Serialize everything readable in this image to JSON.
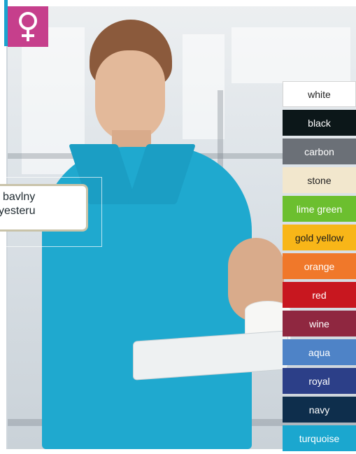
{
  "badge": {
    "icon": "female-symbol-icon",
    "color": "#c63f8c"
  },
  "callout": {
    "line1": "bavlny",
    "line2": "yesteru"
  },
  "colors": [
    {
      "label": "white",
      "bg": "#ffffff",
      "fg": "#222222"
    },
    {
      "label": "black",
      "bg": "#0c1719",
      "fg": "#ffffff"
    },
    {
      "label": "carbon",
      "bg": "#6b7077",
      "fg": "#ffffff"
    },
    {
      "label": "stone",
      "bg": "#f2e7cd",
      "fg": "#222222"
    },
    {
      "label": "lime green",
      "bg": "#6cbf2f",
      "fg": "#ffffff"
    },
    {
      "label": "gold yellow",
      "bg": "#f8b618",
      "fg": "#1a1a1a"
    },
    {
      "label": "orange",
      "bg": "#f0782a",
      "fg": "#ffffff"
    },
    {
      "label": "red",
      "bg": "#c8171f",
      "fg": "#ffffff"
    },
    {
      "label": "wine",
      "bg": "#8f2740",
      "fg": "#ffffff"
    },
    {
      "label": "aqua",
      "bg": "#4e83c7",
      "fg": "#ffffff"
    },
    {
      "label": "royal",
      "bg": "#2c3f88",
      "fg": "#ffffff"
    },
    {
      "label": "navy",
      "bg": "#0e2e4c",
      "fg": "#ffffff"
    },
    {
      "label": "turquoise",
      "bg": "#1ba7cf",
      "fg": "#ffffff"
    }
  ]
}
